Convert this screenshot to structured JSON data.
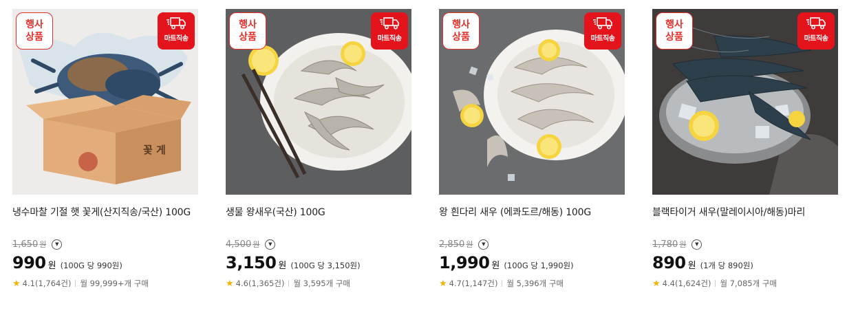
{
  "badges": {
    "event_line1": "행사",
    "event_line2": "상품",
    "mart": "마트직송"
  },
  "products": [
    {
      "name": "냉수마찰 기절 햇 꽃게(산지직송/국산) 100G",
      "original_price": "1,650",
      "original_won": "원",
      "price": "990",
      "won": "원",
      "unit_price": "(100G 당 990원)",
      "rating": "4.1",
      "reviews": "(1,764건)",
      "purchases": "월 99,999+개 구매",
      "box_text": "꽃 게"
    },
    {
      "name": "생물 왕새우(국산) 100G",
      "original_price": "4,500",
      "original_won": "원",
      "price": "3,150",
      "won": "원",
      "unit_price": "(100G 당 3,150원)",
      "rating": "4.6",
      "reviews": "(1,365건)",
      "purchases": "월 3,595개 구매"
    },
    {
      "name": "왕 흰다리 새우 (에콰도르/해동) 100G",
      "original_price": "2,850",
      "original_won": "원",
      "price": "1,990",
      "won": "원",
      "unit_price": "(100G 당 1,990원)",
      "rating": "4.7",
      "reviews": "(1,147건)",
      "purchases": "월 5,396개 구매"
    },
    {
      "name": "블랙타이거 새우(말레이시아/해동)마리",
      "original_price": "1,780",
      "original_won": "원",
      "price": "890",
      "won": "원",
      "unit_price": "(1개 당 890원)",
      "rating": "4.4",
      "reviews": "(1,624건)",
      "purchases": "월 7,085개 구매"
    }
  ],
  "colors": {
    "badge_red": "#e4141d",
    "star": "#f5b400"
  },
  "icons": {
    "mart": "delivery-truck-icon",
    "rating": "star-icon",
    "info": "chevron-down-icon"
  }
}
